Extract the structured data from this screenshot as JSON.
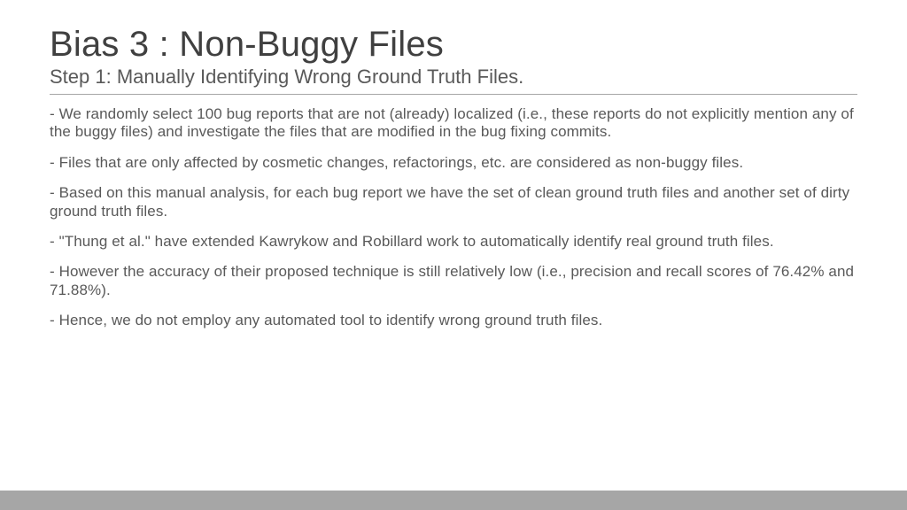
{
  "slide": {
    "title": "Bias 3 : Non-Buggy Files",
    "subtitle": "Step 1: Manually Identifying Wrong Ground Truth Files.",
    "paragraphs": [
      "- We randomly select 100 bug reports that are not (already) localized (i.e., these reports do not explicitly mention any of the buggy files) and investigate the files that are modified in the bug fixing commits.",
      "- Files that are only affected by cosmetic changes, refactorings, etc. are considered as non-buggy files.",
      "- Based on this manual analysis, for each bug report we have the set of clean ground truth files and another set of dirty ground truth files.",
      "- \"Thung et al.\" have extended Kawrykow and Robillard work to automatically identify real ground truth files.",
      "- However the accuracy of their proposed technique is still relatively low (i.e., precision and recall scores of 76.42% and 71.88%).",
      "- Hence, we do not employ any automated tool to identify wrong ground truth files."
    ]
  }
}
